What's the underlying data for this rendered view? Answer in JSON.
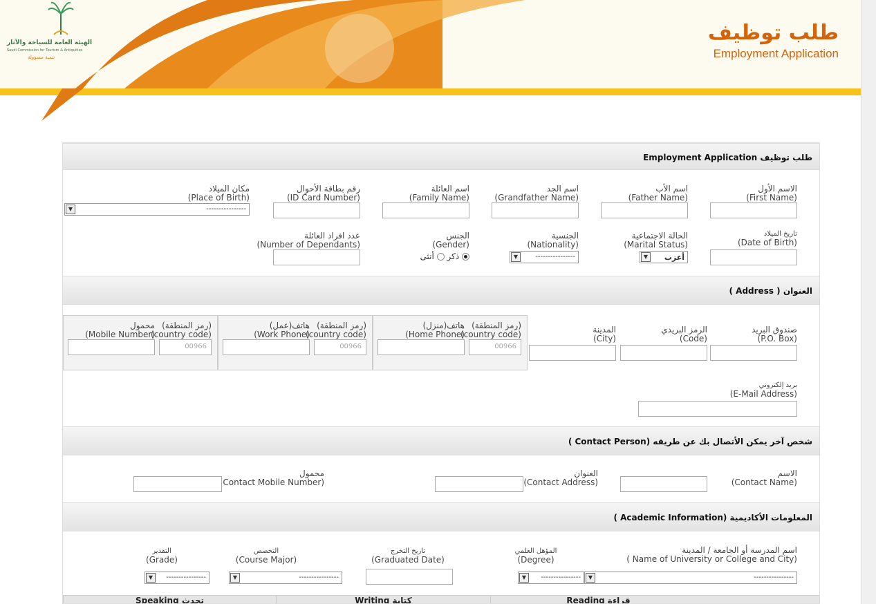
{
  "header": {
    "logo_text_ar": "الهيئة العامة للسياحة والآثار",
    "logo_text_en": "Saudi Commission for Tourism & Antiquities",
    "logo_slogan": "تنمية مسؤولة",
    "title_ar": "طلب توظيف",
    "title_en": "Employment Application"
  },
  "colors": {
    "accent": "#e07a14",
    "yellow": "#f7c21c",
    "brand_text": "#d2640c"
  },
  "sections": {
    "employment": "طلب توظيف Employment Application",
    "address": "العنوان ( Address )",
    "contact": "شخص آخر يمكن الأتصال بك عن طريقه (Contact Person )",
    "academic": "المعلومات الأكاديمية (Academic Information )"
  },
  "personal": {
    "first_name": {
      "ar": "الاسم الأول",
      "en": "(First Name)"
    },
    "father_name": {
      "ar": "اسم الأب",
      "en": "(Father Name)"
    },
    "grandfather_name": {
      "ar": "اسم الجد",
      "en": "(Grandfather Name)"
    },
    "family_name": {
      "ar": "اسم العائلة",
      "en": "(Family Name)"
    },
    "id_card": {
      "ar": "رقم بطاقة الأحوال",
      "en": "(ID Card Number)"
    },
    "place_of_birth": {
      "ar": "مكان الميلاد",
      "en": "(Place of Birth)",
      "value": "----------------"
    },
    "dob": {
      "ar": "تاريخ الميلاد",
      "en": "(Date of Birth)"
    },
    "marital": {
      "ar": "الحالة الاجتماعية",
      "en": "(Marital Status)",
      "value": "أعزب"
    },
    "nationality": {
      "ar": "الجنسية",
      "en": "(Nationality)",
      "value": "----------------"
    },
    "gender": {
      "ar": "الجنس",
      "en": "(Gender)",
      "male": "ذكر",
      "female": "أنثى",
      "selected": "male"
    },
    "dependants": {
      "ar": "عدد افراد العائلة",
      "en": "(Number of Dependants)"
    }
  },
  "address": {
    "po_box": {
      "ar": "صندوق البريد",
      "en": "(P.O. Box)"
    },
    "code": {
      "ar": "الرمز البريدي",
      "en": "(Code)"
    },
    "city": {
      "ar": "المدينة",
      "en": "(City)"
    },
    "home_phone": {
      "ar": "هاتف(منزل)",
      "en": "(Home Phone)",
      "cc_ar": "(رمز المنطقة)",
      "cc_en": "(country code)",
      "cc_value": "00966"
    },
    "work_phone": {
      "ar": "هاتف(عمل)",
      "en": "(Work Phone)",
      "cc_ar": "(رمز المنطقة)",
      "cc_en": "(country code)",
      "cc_value": "00966"
    },
    "mobile": {
      "ar": "محمول",
      "en": "(Mobile Number)",
      "cc_ar": "(رمز المنطقة)",
      "cc_en": "(country code)",
      "cc_value": "00966"
    },
    "email": {
      "ar": "بريد إلكتروني",
      "en": "(E-Mail Address)"
    }
  },
  "contact": {
    "name": {
      "ar": "الاسم",
      "en": "(Contact Name)"
    },
    "address": {
      "ar": "العنوان",
      "en": "(Contact Address)"
    },
    "mobile": {
      "ar": "محمول",
      "en": "(Contact Mobile Number)"
    }
  },
  "academic": {
    "university": {
      "ar": "اسم المدرسة أو الجامعة / المدينة",
      "en": "( Name of University or College and City)",
      "value": "----------------"
    },
    "degree": {
      "ar": "المؤهل العلمي",
      "en": "(Degree)",
      "value": "----------------"
    },
    "graduated": {
      "ar": "تاريخ التخرج",
      "en": "(Graduated Date)"
    },
    "major": {
      "ar": "التخصص",
      "en": "(Course Major)",
      "value": "----------------"
    },
    "grade": {
      "ar": "التقدير",
      "en": "(Grade)",
      "value": "----------------"
    }
  },
  "languages": {
    "reading": "Reading قراءة",
    "writing": "Writing كتابة",
    "speaking": "Speaking تحدث"
  }
}
